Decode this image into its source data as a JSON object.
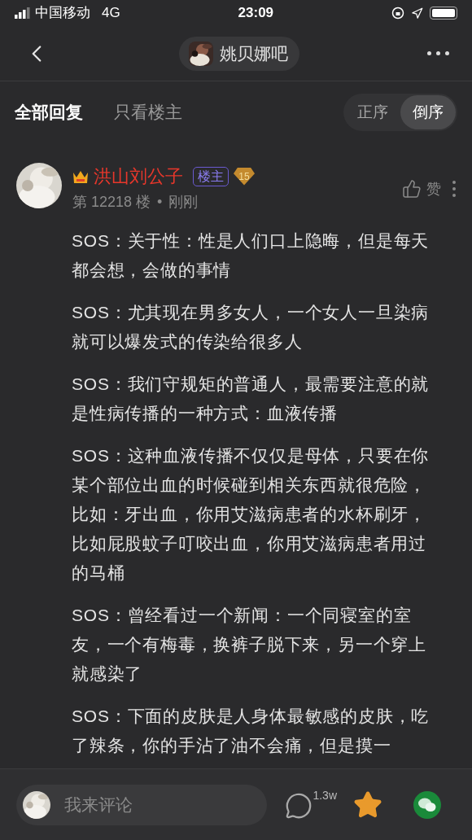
{
  "status_bar": {
    "carrier": "中国移动",
    "network": "4G",
    "time": "23:09"
  },
  "nav": {
    "forum": "姚贝娜吧"
  },
  "filters": [
    {
      "label": "全部回复",
      "selected": true
    },
    {
      "label": "只看楼主",
      "selected": false
    }
  ],
  "sort": [
    {
      "label": "正序",
      "selected": false
    },
    {
      "label": "倒序",
      "selected": true
    }
  ],
  "post": {
    "author": "洪山刘公子",
    "badge": "楼主",
    "level": "15",
    "floor": "第 12218 楼",
    "separator": "•",
    "time": "刚刚",
    "like": "赞",
    "paragraphs": [
      "SOS：关于性：性是人们口上隐晦，但是每天都会想，会做的事情",
      "SOS：尤其现在男多女人，一个女人一旦染病就可以爆发式的传染给很多人",
      "SOS：我们守规矩的普通人，最需要注意的就是性病传播的一种方式：血液传播",
      "SOS：这种血液传播不仅仅是母体，只要在你某个部位出血的时候碰到相关东西就很危险，比如：牙出血，你用艾滋病患者的水杯刷牙，比如屁股蚊子叮咬出血，你用艾滋病患者用过的马桶",
      "SOS：曾经看过一个新闻：一个同寝室的室友，一个有梅毒，换裤子脱下来，另一个穿上就感染了",
      "SOS：下面的皮肤是人身体最敏感的皮肤，吃了辣条，你的手沾了油不会痛，但是摸一"
    ]
  },
  "bottom_bar": {
    "placeholder": "我来评论",
    "comment_count": "1.3w"
  }
}
